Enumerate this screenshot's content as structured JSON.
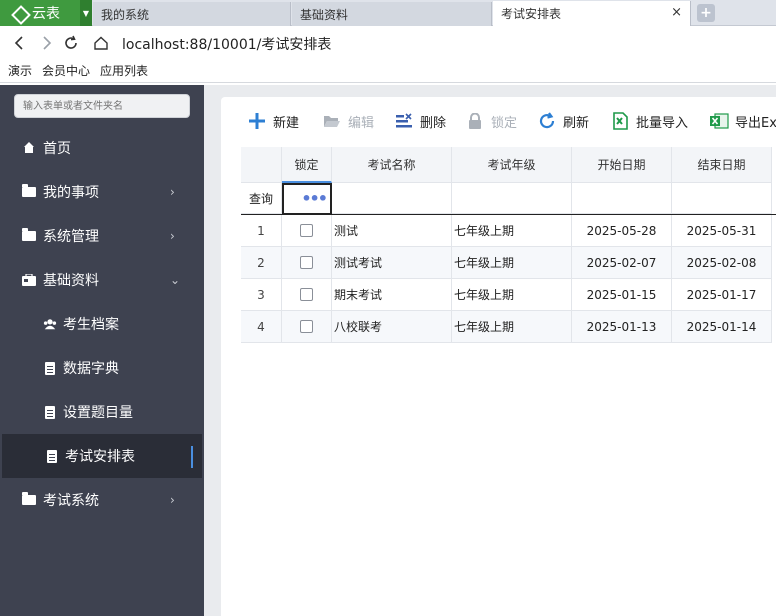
{
  "browser": {
    "brand": "云表",
    "tabs": [
      {
        "label": "我的系统"
      },
      {
        "label": "基础资料"
      },
      {
        "label": "考试安排表",
        "close": "×"
      }
    ],
    "new_tab": "+",
    "url": "localhost:88/10001/考试安排表",
    "bookmarks": [
      "演示",
      "会员中心",
      "应用列表"
    ]
  },
  "sidebar": {
    "search_placeholder": "输入表单或者文件夹名",
    "items": [
      {
        "label": "首页",
        "icon": "home-icon",
        "arrow": ""
      },
      {
        "label": "我的事项",
        "icon": "folder-icon",
        "arrow": "›"
      },
      {
        "label": "系统管理",
        "icon": "folder-icon",
        "arrow": "›"
      },
      {
        "label": "基础资料",
        "icon": "briefcase-icon",
        "arrow": "⌄"
      },
      {
        "label": "考生档案",
        "icon": "users-icon",
        "arrow": ""
      },
      {
        "label": "数据字典",
        "icon": "document-icon",
        "arrow": ""
      },
      {
        "label": "设置题目量",
        "icon": "document-icon",
        "arrow": ""
      },
      {
        "label": "考试安排表",
        "icon": "document-icon",
        "arrow": ""
      },
      {
        "label": "考试系统",
        "icon": "folder-icon",
        "arrow": "›"
      }
    ]
  },
  "toolbar": {
    "new": "新建",
    "edit": "编辑",
    "delete": "删除",
    "lock": "锁定",
    "refresh": "刷新",
    "import": "批量导入",
    "export": "导出Ex"
  },
  "grid": {
    "headers": [
      "",
      "锁定",
      "考试名称",
      "考试年级",
      "开始日期",
      "结束日期"
    ],
    "filter_label": "查询",
    "filter_dots": "•••",
    "rows": [
      {
        "num": "1",
        "name": "测试",
        "grade": "七年级上期",
        "start": "2025-05-28",
        "end": "2025-05-31"
      },
      {
        "num": "2",
        "name": "测试考试",
        "grade": "七年级上期",
        "start": "2025-02-07",
        "end": "2025-02-08"
      },
      {
        "num": "3",
        "name": "期末考试",
        "grade": "七年级上期",
        "start": "2025-01-15",
        "end": "2025-01-17"
      },
      {
        "num": "4",
        "name": "八校联考",
        "grade": "七年级上期",
        "start": "2025-01-13",
        "end": "2025-01-14"
      }
    ]
  },
  "colors": {
    "brand_green": "#3f9a3f",
    "sidebar_bg": "#3e4250",
    "sidebar_selected": "#2a2d37",
    "accent_blue": "#4a8fe0"
  }
}
